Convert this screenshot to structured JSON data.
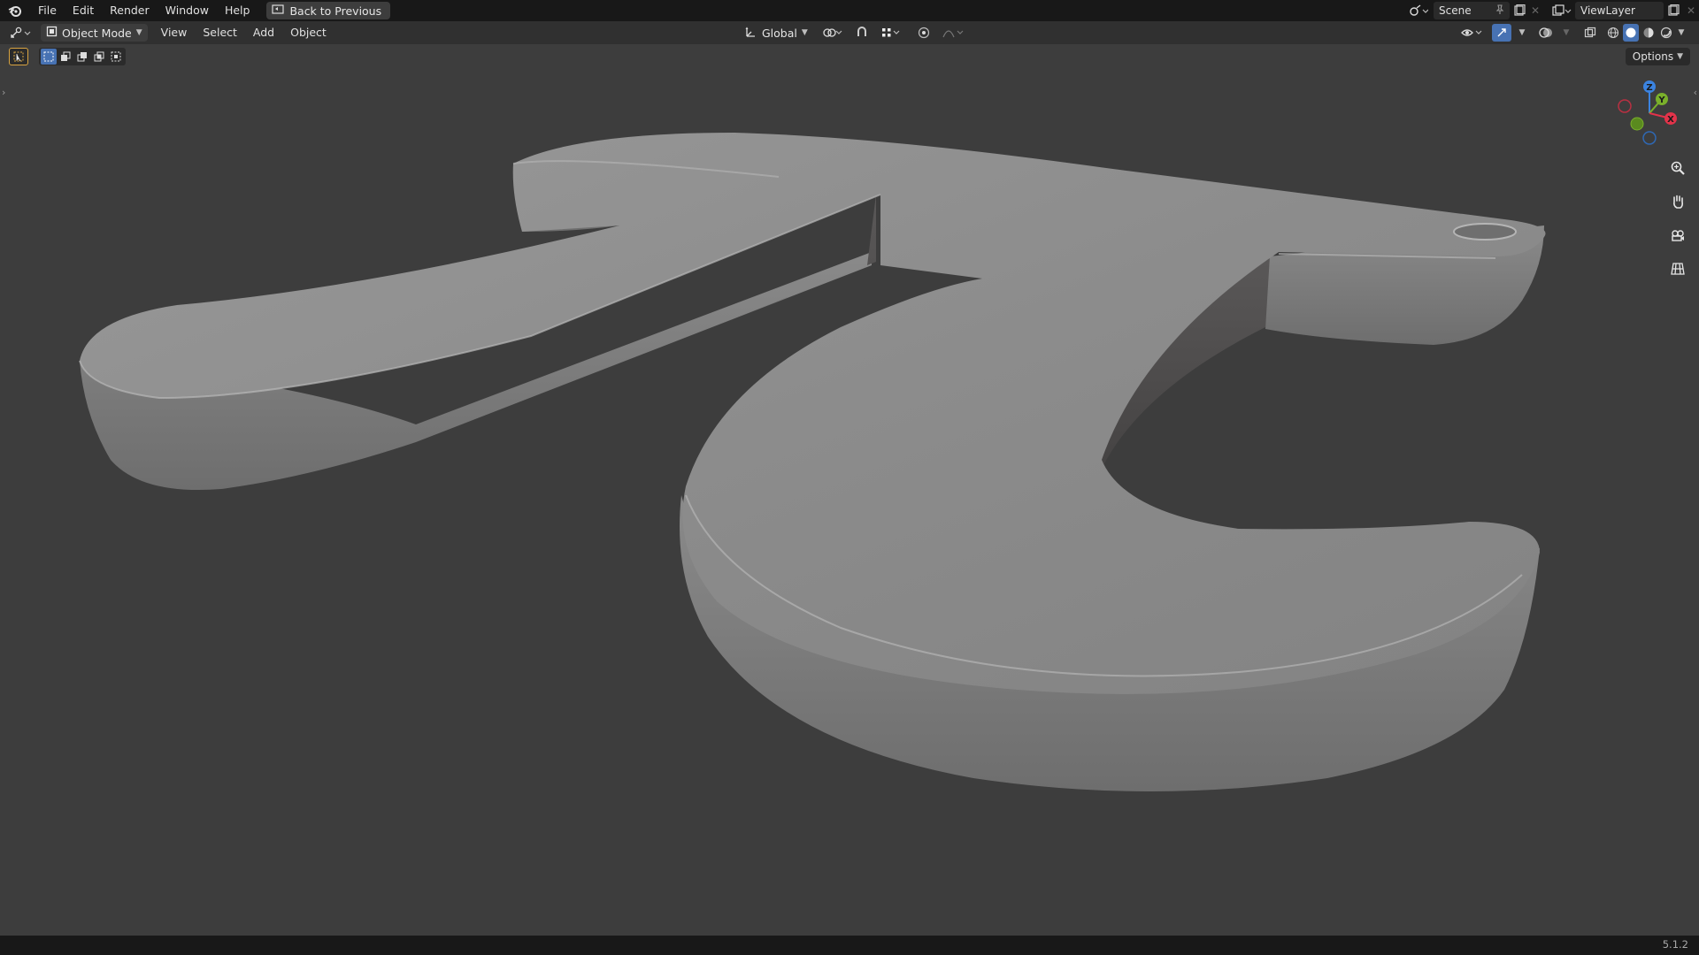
{
  "top_menu": {
    "items": [
      "File",
      "Edit",
      "Render",
      "Window",
      "Help"
    ],
    "back_button": "Back to Previous"
  },
  "top_right": {
    "scene": "Scene",
    "view_layer": "ViewLayer"
  },
  "viewport_header": {
    "mode": "Object Mode",
    "menus": [
      "View",
      "Select",
      "Add",
      "Object"
    ],
    "transform_orientation": "Global",
    "options_label": "Options"
  },
  "gizmo": {
    "axes": [
      "X",
      "Y",
      "Z"
    ],
    "colors": {
      "x": "#e3334a",
      "y": "#7ab02b",
      "z": "#3b83e0"
    }
  },
  "icons": [
    "blender-logo-icon",
    "screen-icon",
    "editor-type-icon",
    "object-mode-icon",
    "transform-orientation-icon",
    "pivot-icon",
    "snap-icon",
    "proportional-edit-icon",
    "visibility-icon",
    "gizmo-icon",
    "overlay-icon",
    "xray-icon",
    "wireframe-shading-icon",
    "solid-shading-icon",
    "material-shading-icon",
    "rendered-shading-icon",
    "zoom-icon",
    "pan-icon",
    "camera-icon",
    "grid-icon"
  ],
  "status_bar": {
    "version": "5.1.2"
  },
  "scene_object": "pi-symbol-mesh"
}
